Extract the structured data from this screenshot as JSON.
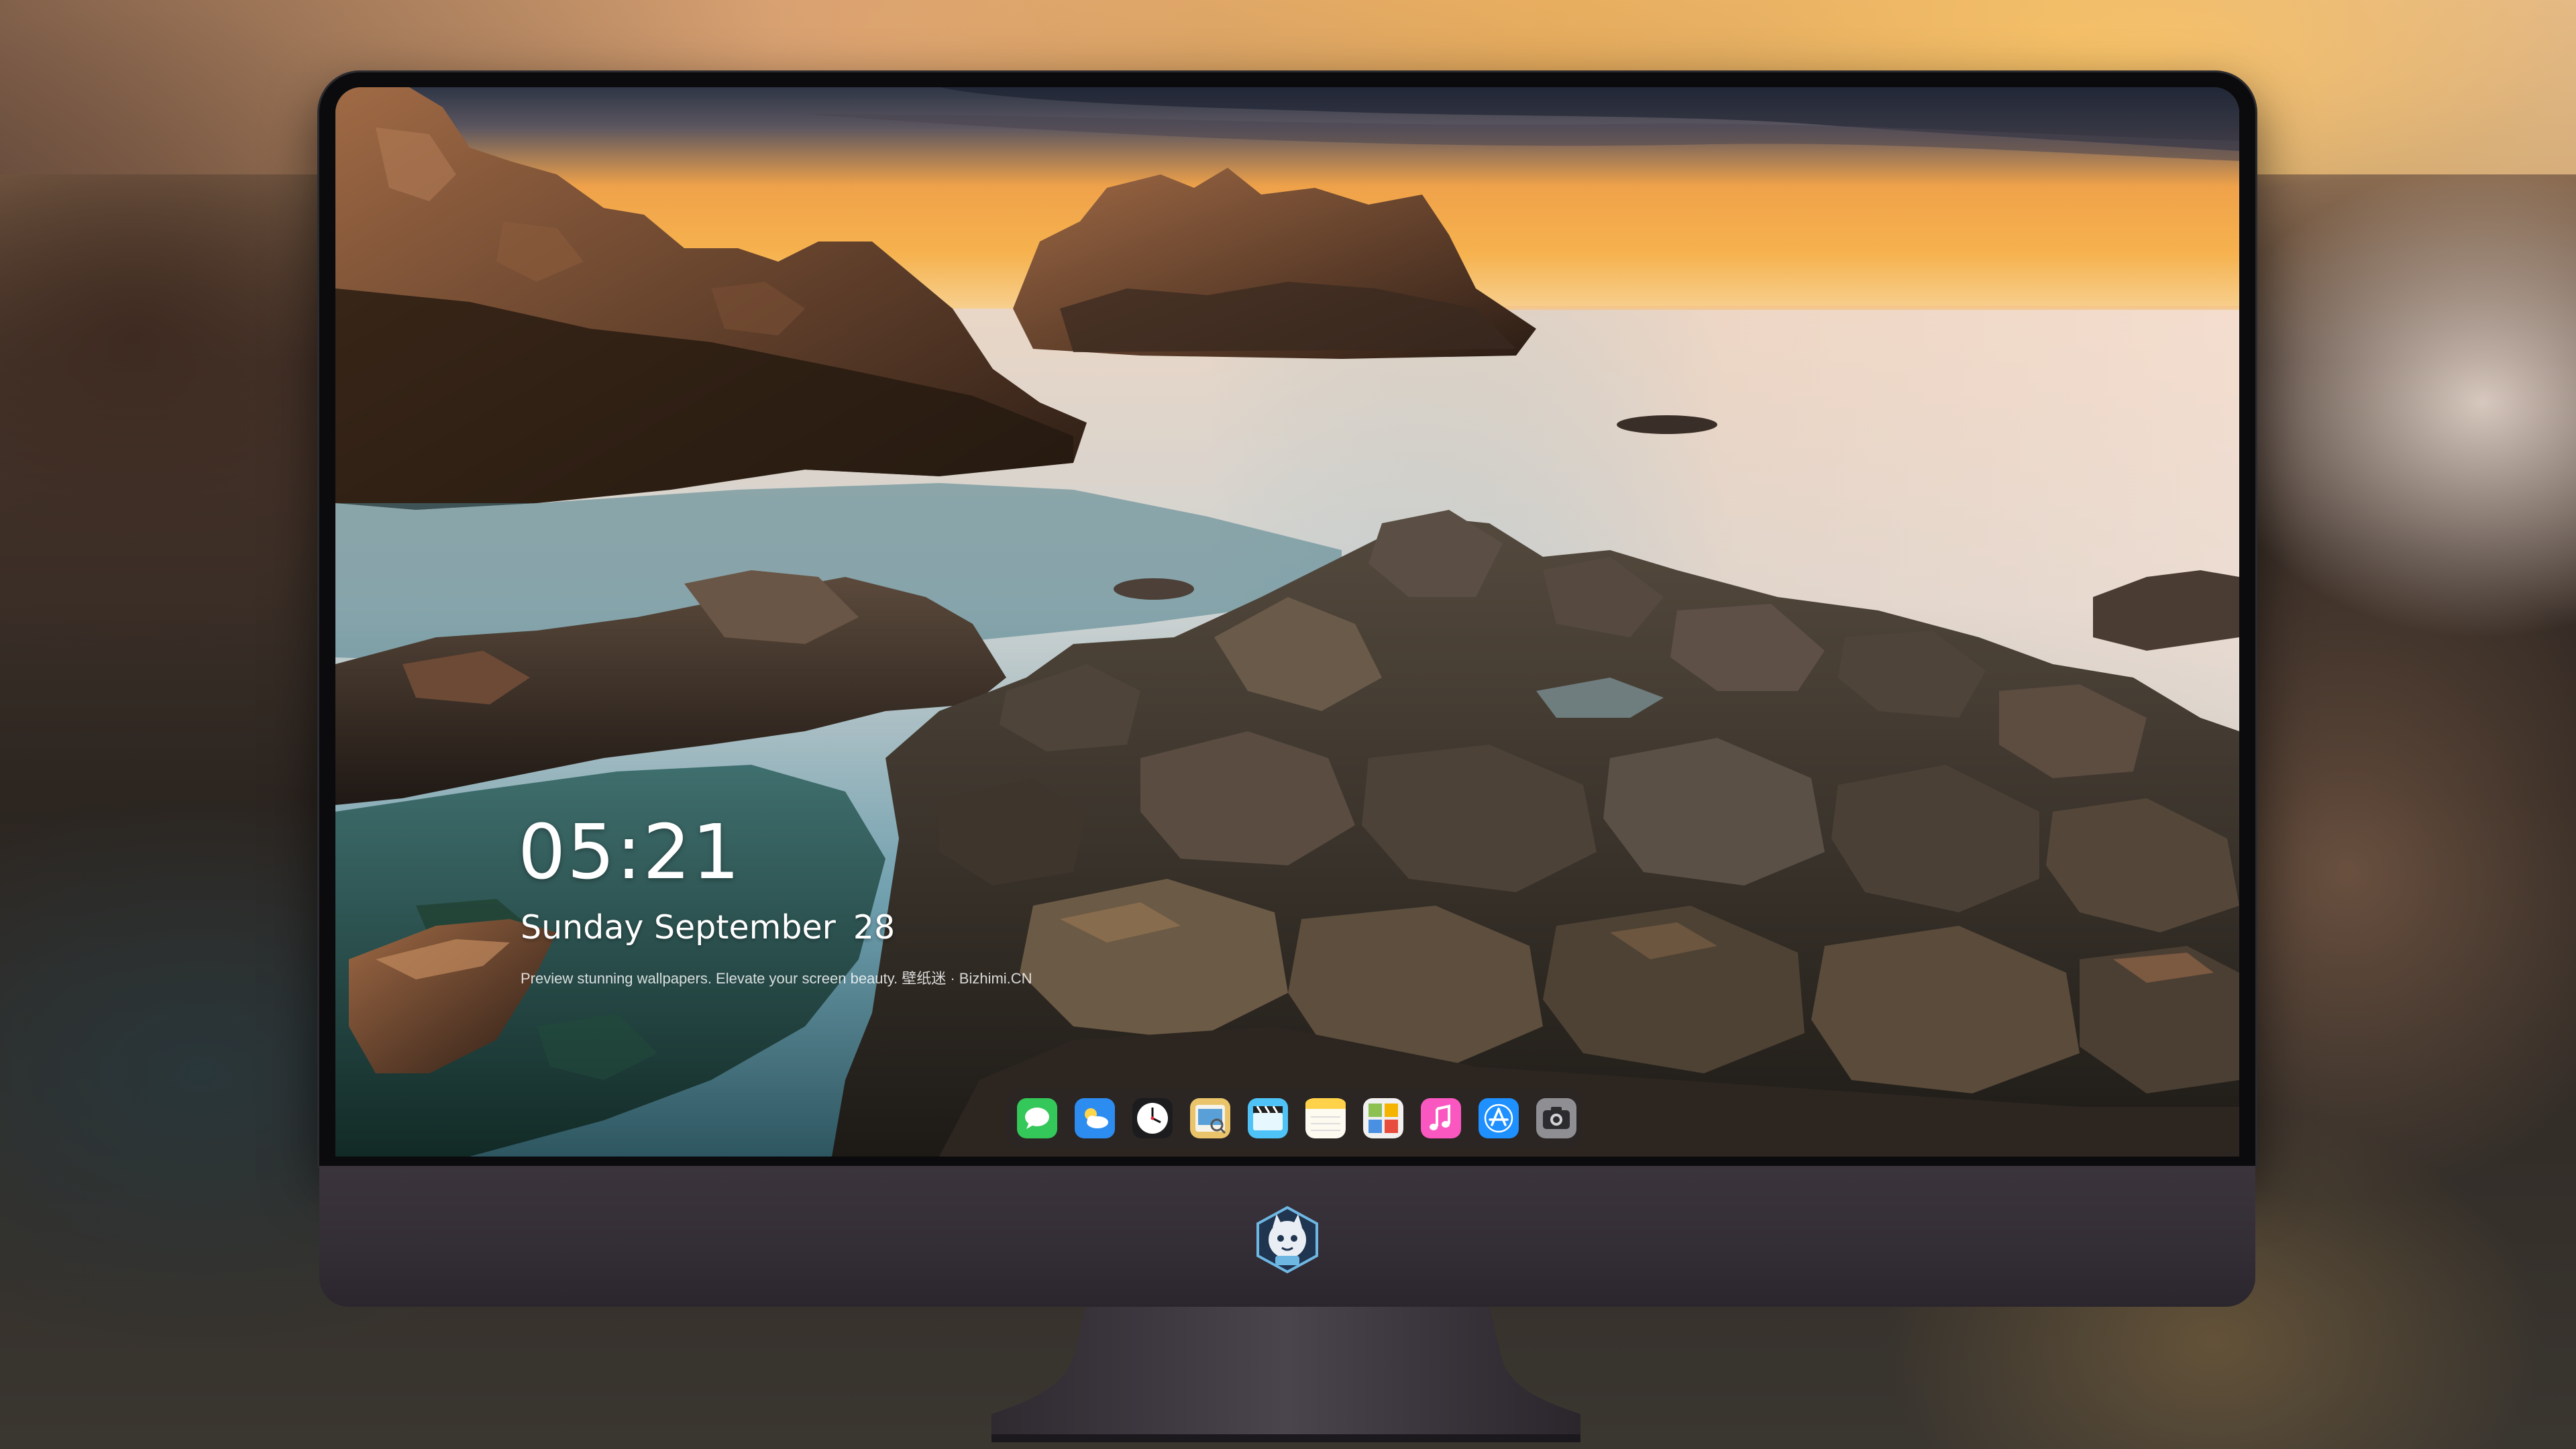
{
  "lockscreen": {
    "time": "05:21",
    "weekday_month": "Sunday September",
    "day": "28",
    "caption": "Preview stunning wallpapers. Elevate your screen beauty. 壁纸迷 · Bizhimi.CN"
  },
  "dock": {
    "apps": [
      {
        "name": "Messages",
        "icon": "messages-icon",
        "color": "#34c759"
      },
      {
        "name": "Weather",
        "icon": "weather-icon",
        "color": "#2d8cf0"
      },
      {
        "name": "Clock",
        "icon": "clock-icon",
        "color": "#ffffff"
      },
      {
        "name": "Preview",
        "icon": "preview-icon",
        "color": "#e9c46a"
      },
      {
        "name": "Clips",
        "icon": "clips-icon",
        "color": "#4fc3f7"
      },
      {
        "name": "Notes",
        "icon": "notes-icon",
        "color": "#ffd24a"
      },
      {
        "name": "Photo Booth",
        "icon": "photo-booth-icon",
        "color": "#8cc152"
      },
      {
        "name": "Music",
        "icon": "music-icon",
        "color": "#fa57c1"
      },
      {
        "name": "App Store",
        "icon": "app-store-icon",
        "color": "#1e90ff"
      },
      {
        "name": "Camera",
        "icon": "camera-icon",
        "color": "#8e8e93"
      }
    ]
  },
  "device": {
    "chin_logo": "mascot-logo-icon",
    "bezel_color": "#0b0b0d",
    "chin_color": "#3b343c"
  }
}
